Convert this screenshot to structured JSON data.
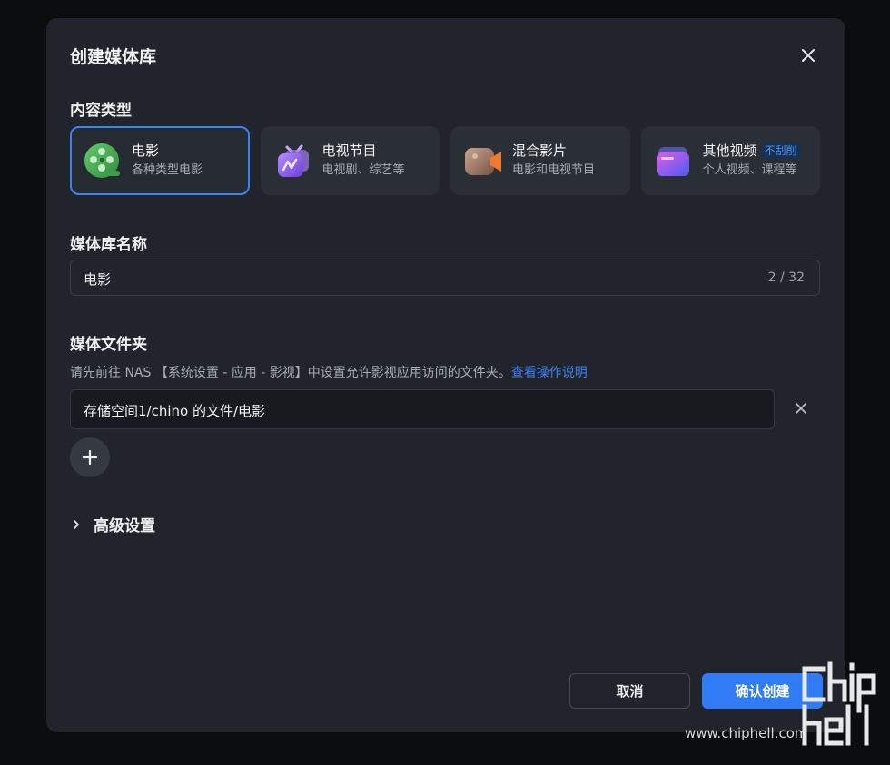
{
  "dialog": {
    "title": "创建媒体库",
    "close_icon": "close-icon"
  },
  "content_type": {
    "label": "内容类型",
    "selected": "电影",
    "options": [
      {
        "name": "电影",
        "desc": "各种类型电影",
        "icon": "film-reel-icon",
        "color": "#4caf50"
      },
      {
        "name": "电视节目",
        "desc": "电视剧、综艺等",
        "icon": "tv-icon",
        "color": "#8e5cf7"
      },
      {
        "name": "混合影片",
        "desc": "电影和电视节目",
        "icon": "video-camera-icon",
        "color": "#f07a2a"
      },
      {
        "name": "其他视频",
        "desc": "个人视频、课程等",
        "icon": "folder-icon",
        "color": "#7b5cf5",
        "badge": "不刮削"
      }
    ]
  },
  "library_name": {
    "label": "媒体库名称",
    "value": "电影",
    "counter": "2 / 32"
  },
  "media_folder": {
    "label": "媒体文件夹",
    "hint": "请先前往 NAS 【系统设置 - 应用 - 影视】中设置允许影视应用访问的文件夹。",
    "hint_link": "查看操作说明",
    "folders": [
      "存储空间1/chino 的文件/电影"
    ]
  },
  "advanced": {
    "label": "高级设置"
  },
  "actions": {
    "cancel": "取消",
    "confirm": "确认创建"
  },
  "watermark": {
    "site": "www.chiphell.com"
  },
  "colors": {
    "accent": "#2f7cf6",
    "dialog_bg": "#21252b",
    "card_bg": "#2a2e35"
  }
}
